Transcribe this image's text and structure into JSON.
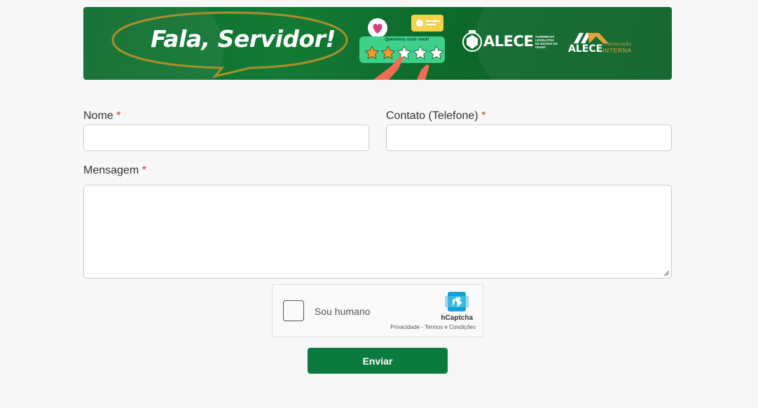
{
  "banner": {
    "title": "Fala, Servidor!",
    "rating_caption": "Queremos ouvir você!",
    "stars_filled": 2,
    "stars_total": 5,
    "logo1": {
      "name": "ALECE",
      "subtitle": "ASSEMBLEIA LEGISLATIVA DO ESTADO DO CEARÁ"
    },
    "logo2": {
      "name": "ALECE",
      "subtitle_small": "COMUNICAÇÃO",
      "subtitle_large": "INTERNA"
    },
    "colors": {
      "green": "#0e6b2d",
      "accent_orange": "#e2a13d"
    }
  },
  "form": {
    "nome": {
      "label": "Nome",
      "required_mark": "*",
      "value": ""
    },
    "contato": {
      "label": "Contato (Telefone)",
      "required_mark": "*",
      "value": ""
    },
    "mensagem": {
      "label": "Mensagem",
      "required_mark": "*",
      "value": ""
    },
    "captcha": {
      "label": "Sou humano",
      "brand": "hCaptcha",
      "privacy": "Privacidade",
      "separator": " - ",
      "terms": "Termos e Condições",
      "checked": false
    },
    "submit_label": "Enviar",
    "colors": {
      "submit": "#0b7a3e",
      "required": "#c0392b"
    }
  }
}
